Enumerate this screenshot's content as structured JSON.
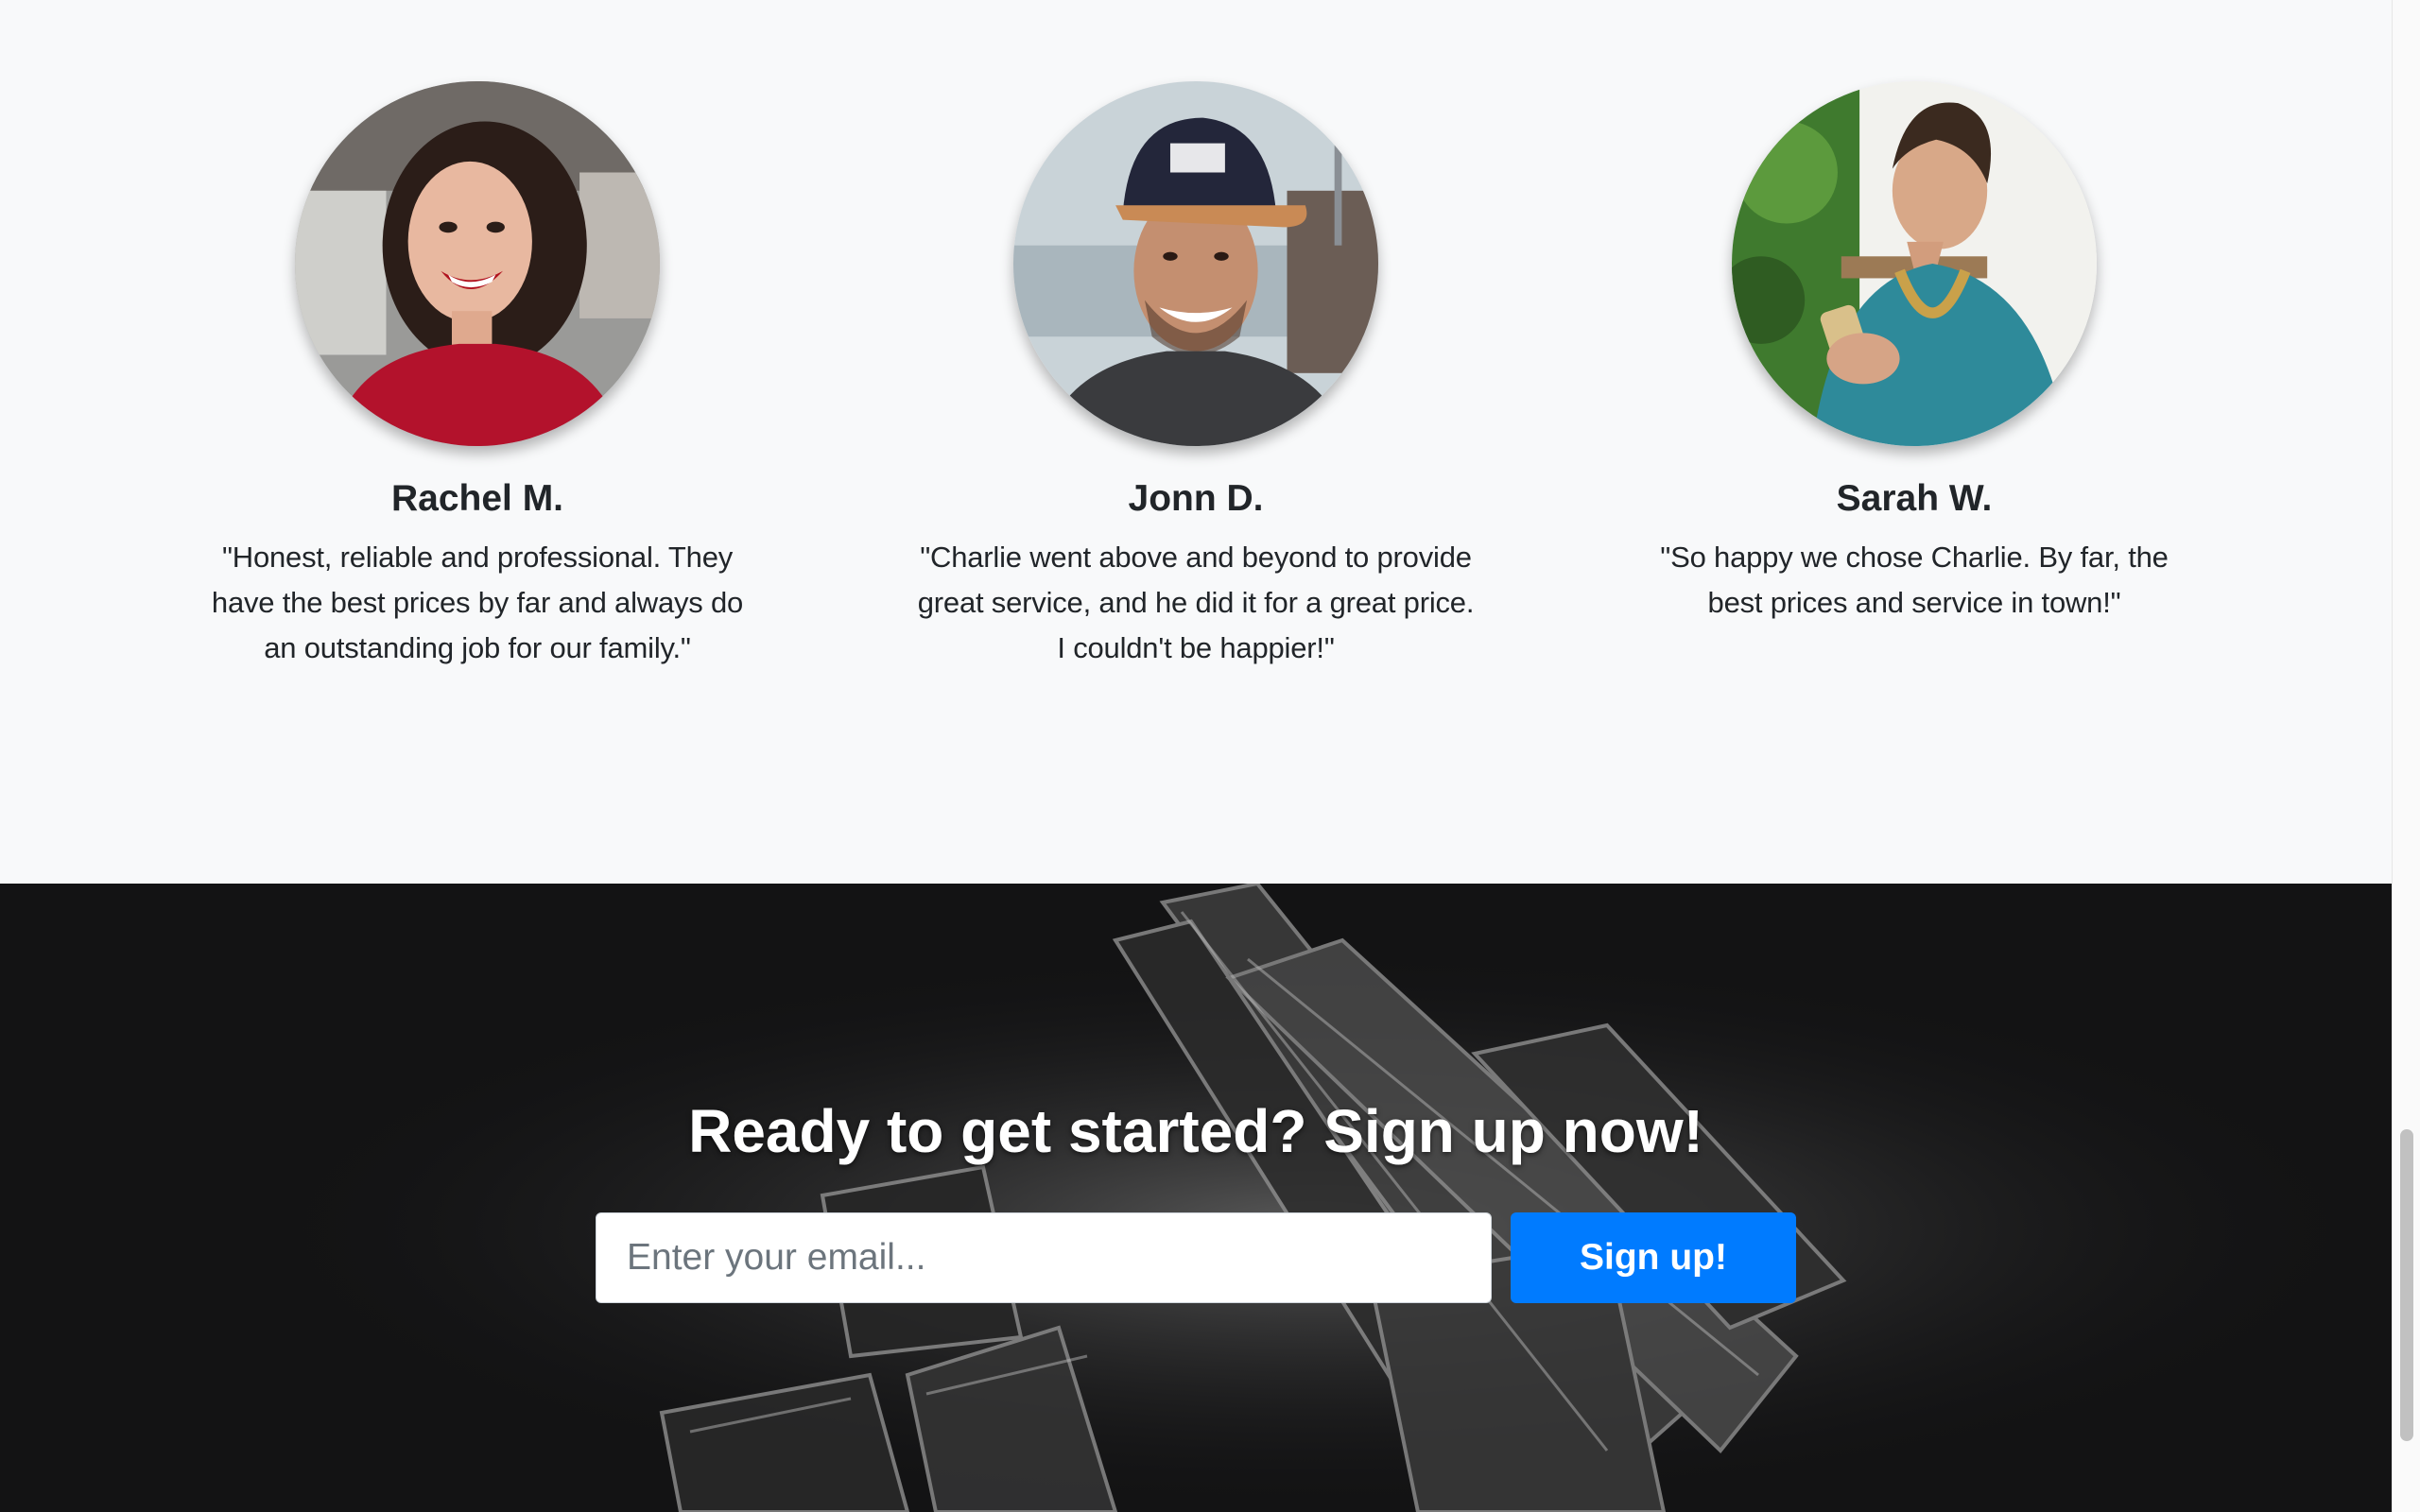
{
  "testimonials": [
    {
      "name": "Rachel M.",
      "quote": "\"Honest, reliable and professional. They have the best prices by far and always do an outstanding job for our family.\"",
      "photo": "smiling-woman-portrait"
    },
    {
      "name": "Jonn D.",
      "quote": "\"Charlie went above and beyond to provide great service, and he did it for a great price. I couldn't be happier!\"",
      "photo": "smiling-man-cap-portrait"
    },
    {
      "name": "Sarah W.",
      "quote": "\"So happy we chose Charlie. By far, the best prices and service in town!\"",
      "photo": "woman-with-phone-portrait"
    }
  ],
  "cta": {
    "title": "Ready to get started? Sign up now!",
    "email_placeholder": "Enter your email...",
    "button_label": "Sign up!"
  },
  "colors": {
    "page_bg": "#f8f9fa",
    "cta_bg": "#131314",
    "accent": "#007bff",
    "text": "#212529"
  }
}
